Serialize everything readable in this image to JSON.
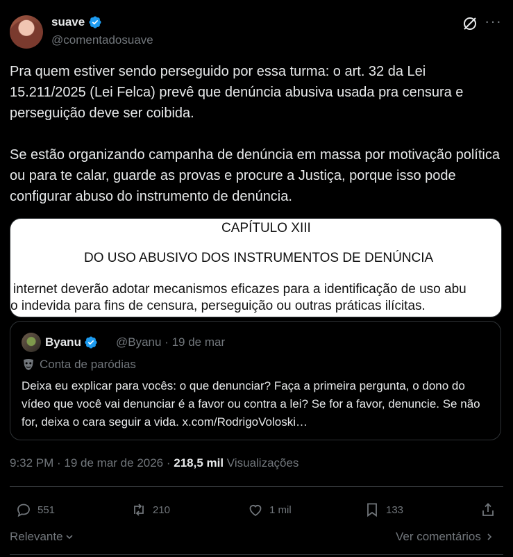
{
  "author": {
    "name": "suave",
    "handle": "@comentadosuave"
  },
  "post": {
    "text": "Pra quem estiver sendo perseguido por essa turma: o art. 32 da Lei 15.211/2025 (Lei Felca) prevê que denúncia abusiva usada pra censura e perseguição deve ser coibida.\n\nSe estão organizando campanha de denúncia em massa por motivação política ou para te calar, guarde as provas e procure a Justiça, porque isso pode configurar abuso do instrumento de denúncia."
  },
  "media": {
    "heading": "CAPÍTULO XIII",
    "subheading": "DO USO ABUSIVO DOS INSTRUMENTOS DE DENÚNCIA",
    "line1": "internet deverão adotar mecanismos eficazes para a identificação de uso abu",
    "line2": "o indevida para fins de censura, perseguição ou outras práticas ilícitas."
  },
  "quote": {
    "name": "Byanu",
    "meta": "@Byanu · 19 de mar",
    "parody_label": "Conta de paródias",
    "text": "Deixa eu explicar para vocês: o que denunciar? Faça a primeira pergunta, o dono do vídeo que você vai denunciar é a favor ou contra a lei? Se for a favor, denuncie. Se não for, deixa o cara seguir a vida. x.com/RodrigoVoloski…"
  },
  "meta": {
    "time": "9:32 PM · 19 de mar de 2026 · ",
    "views_count": "218,5 mil",
    "views_label": " Visualizações"
  },
  "actions": {
    "replies": "551",
    "reposts": "210",
    "likes": "1 mil",
    "bookmarks": "133"
  },
  "footer": {
    "sort_label": "Relevante",
    "view_comments": "Ver comentários"
  },
  "colors": {
    "background": "#000000",
    "text": "#e7e9ea",
    "muted": "#71767b",
    "border": "#2f3336",
    "verified": "#1d9bf0"
  }
}
